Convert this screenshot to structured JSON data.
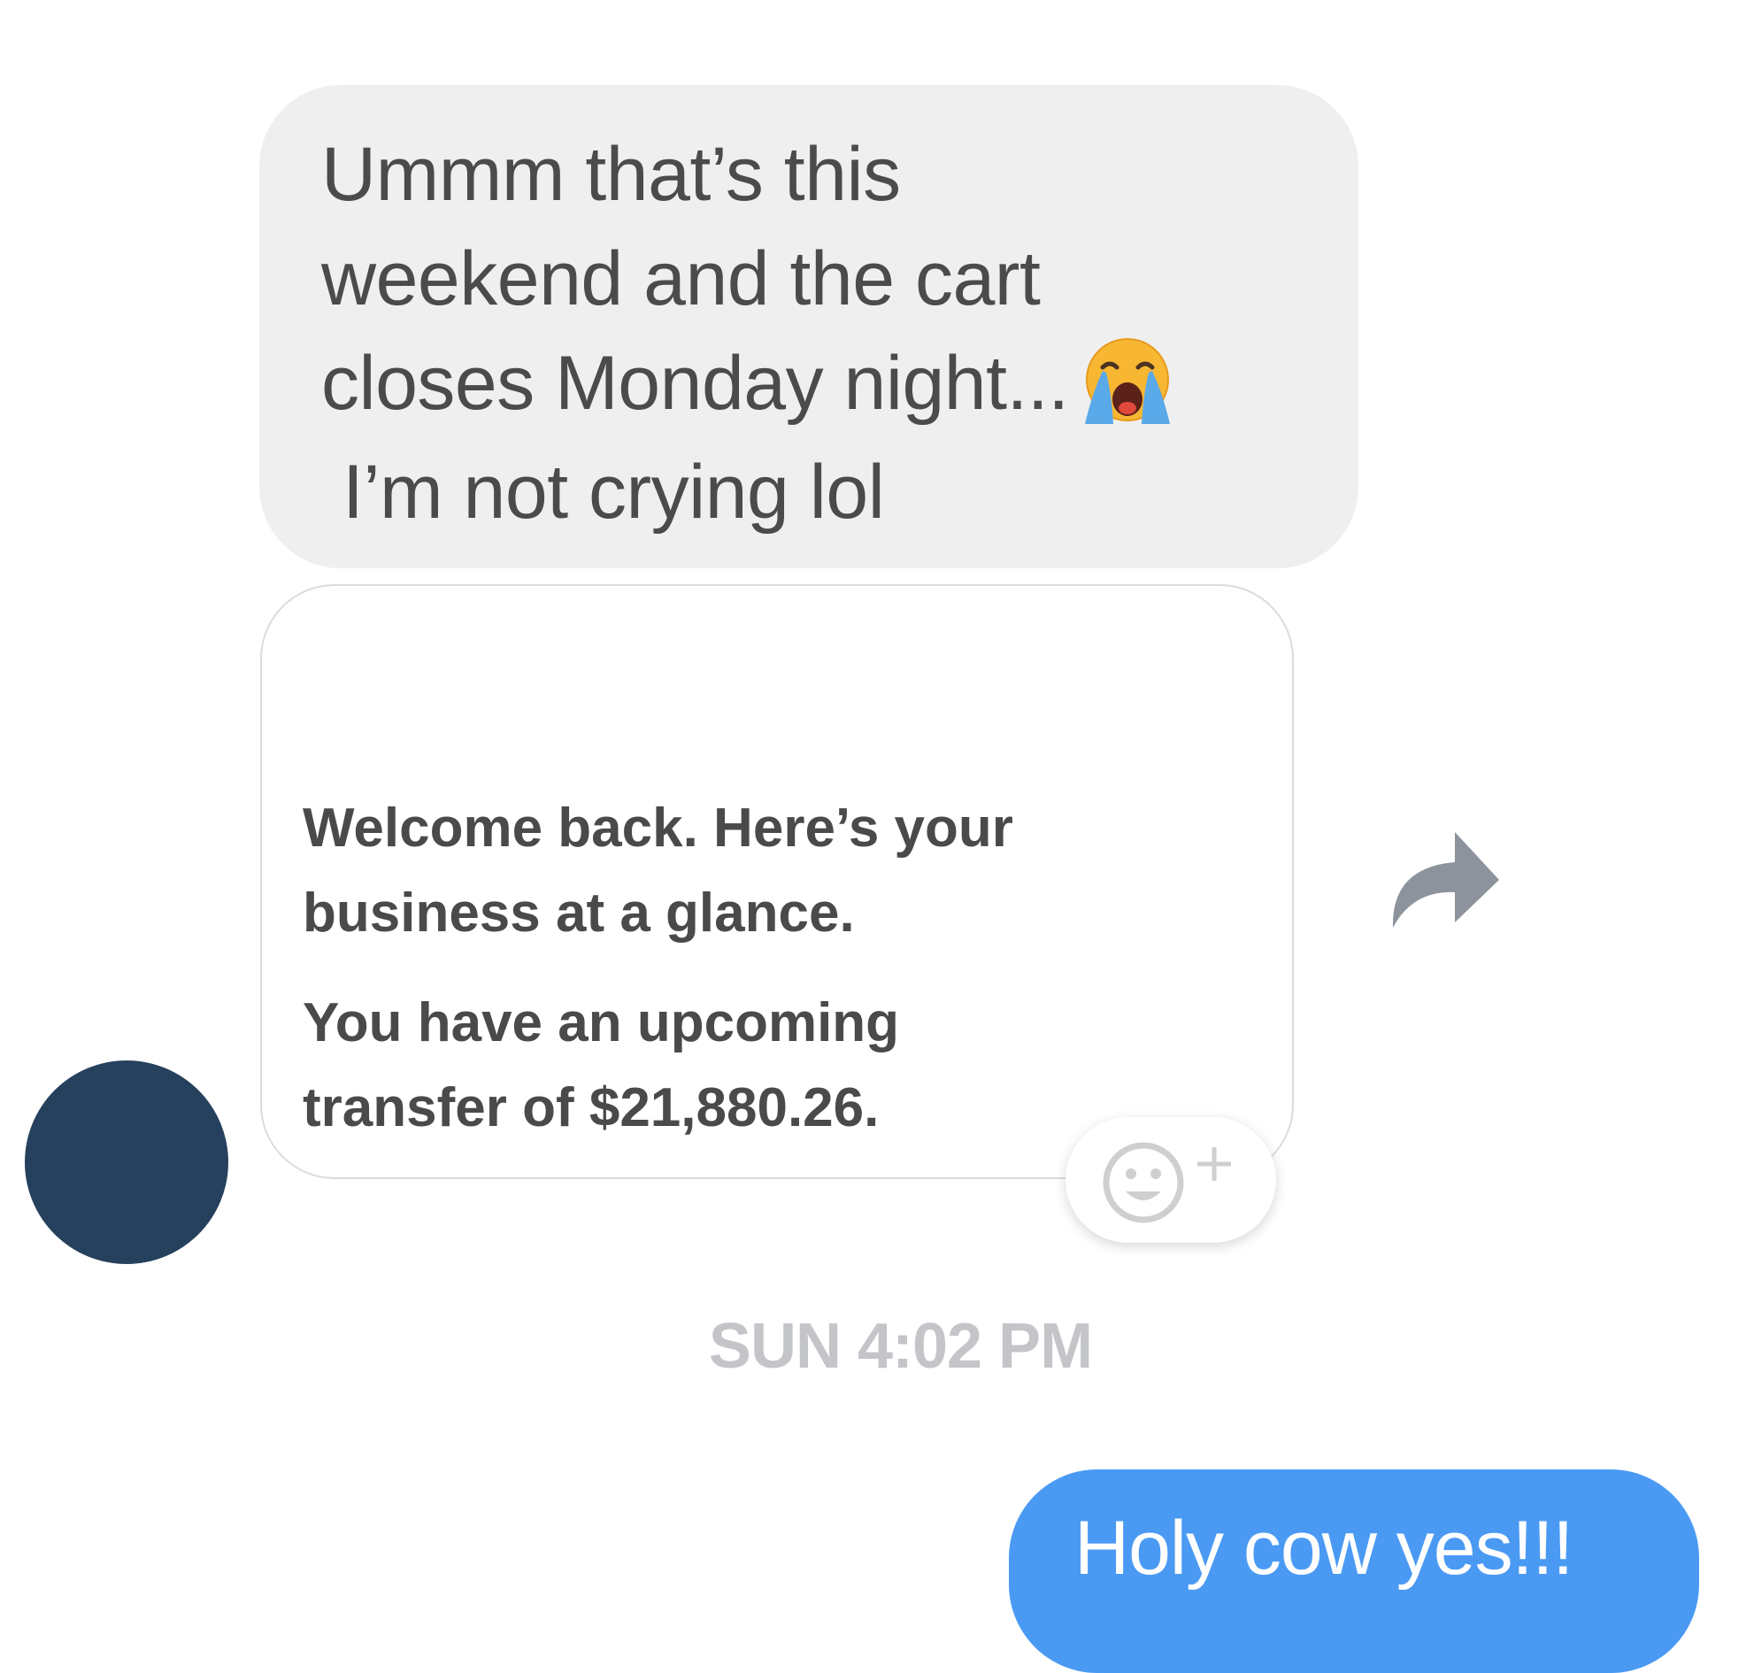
{
  "incoming_message": {
    "lines": [
      "Ummm that’s this",
      "weekend and the cart",
      "closes Monday night...",
      "I’m not crying lol"
    ],
    "emoji": "loudly-crying-face"
  },
  "shared_card": {
    "line1": "Welcome back. Here’s your",
    "line2": "business at a glance.",
    "line3": "You have an upcoming",
    "line4": "transfer of $21,880.26."
  },
  "timestamp": "SUN 4:02 PM",
  "outgoing_message": {
    "text": "Holy cow yes!!!"
  },
  "icons": {
    "share": "share-arrow-icon",
    "react": "add-reaction-icon"
  },
  "colors": {
    "incoming_bubble": "#efefef",
    "outgoing_bubble": "#4a9af4",
    "avatar": "#26415e",
    "timestamp": "#c4c5c9"
  }
}
